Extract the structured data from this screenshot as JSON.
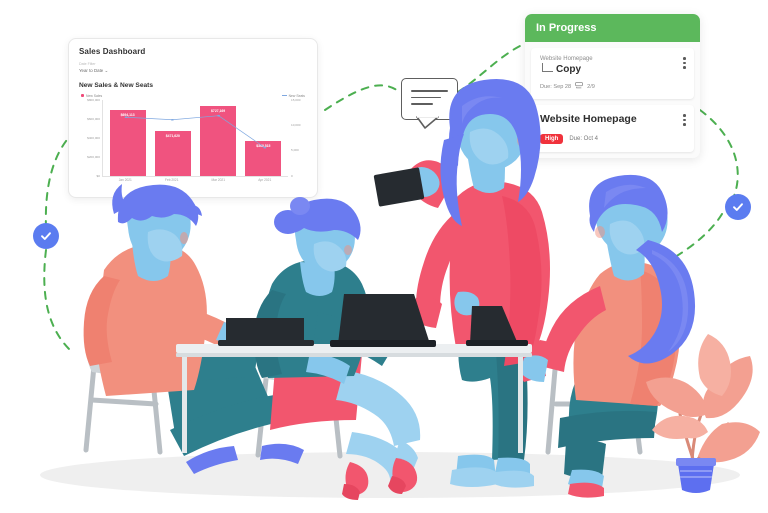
{
  "dashboard": {
    "title": "Sales Dashboard",
    "filter_label": "Date Filter",
    "filter_value": "Year to Date ⌄",
    "subtitle": "New Sales & New Seats",
    "legend": [
      {
        "name": "New Sales",
        "type": "bar",
        "color": "#ef4a79"
      },
      {
        "name": "New Seats",
        "type": "line",
        "color": "#7fa8e0"
      }
    ],
    "chart_data": {
      "type": "bar",
      "title": "New Sales & New Seats",
      "xlabel": "",
      "ylabel": "New Sales",
      "categories": [
        "Jan 2021",
        "Feb 2021",
        "Mar 2021",
        "Apr 2021"
      ],
      "values": [
        694113,
        471620,
        727169,
        368515
      ],
      "value_labels": [
        "$694,113",
        "$471,620",
        "$727,169",
        "$368,515"
      ],
      "ylim": [
        0,
        800000
      ],
      "yticks": [
        "$800,000",
        "$600,000",
        "$400,000",
        "$200,000",
        "$0"
      ],
      "ytick_values": [
        800000,
        600000,
        400000,
        200000,
        0
      ],
      "y2label": "New Seats",
      "y2lim": [
        0,
        15000
      ],
      "y2ticks": [
        "15,000",
        "10,000",
        "5,000",
        "0"
      ],
      "y2tick_values": [
        15000,
        10000,
        5000,
        0
      ],
      "series": [
        {
          "name": "New Sales",
          "type": "bar",
          "axis": "left",
          "color": "#f0537f",
          "values": [
            694113,
            471620,
            727169,
            368515
          ]
        },
        {
          "name": "New Seats",
          "type": "line",
          "axis": "right",
          "color": "#7fa8e0",
          "values": [
            11600,
            11100,
            11900,
            5600
          ]
        }
      ],
      "grid": false,
      "legend_position": "top"
    }
  },
  "kanban": {
    "column_title": "In Progress",
    "cards": [
      {
        "parent": "Website Homepage",
        "title": "Copy",
        "due": "Due: Sep 28",
        "subtasks": "2/9",
        "menu_icon": "kebab-menu-icon",
        "subtask_icon": "subtask-icon"
      },
      {
        "title": "Website Homepage",
        "priority": "High",
        "priority_color": "#f0323c",
        "due": "Due: Oct 4",
        "menu_icon": "kebab-menu-icon"
      }
    ]
  },
  "annotations": {
    "chat_bubble": {
      "icon": "chat-bubble-icon",
      "lines": 3
    },
    "check_left": {
      "icon": "check-circle-icon",
      "color": "#5b7cf0"
    },
    "check_right": {
      "icon": "check-circle-icon",
      "color": "#5b7cf0"
    },
    "connector_color": "#4caf50",
    "connector_style": "dashed"
  },
  "illustration": {
    "scene": "team-collaboration-at-desk",
    "people": [
      {
        "id": "person-left-seated",
        "top": "#f2907e",
        "bottom": "#2e7f8d",
        "hair": "#6a7bf0",
        "skin": "#86c7ec"
      },
      {
        "id": "person-second-seated",
        "top": "#2e7f8d",
        "bottom": "#f2566e",
        "hair": "#6a7bf0",
        "skin": "#86c7ec"
      },
      {
        "id": "person-standing-tablet",
        "top": "#f2566e",
        "bottom": "#2e7f8d",
        "hair": "#6a7bf0",
        "skin": "#86c7ec"
      },
      {
        "id": "person-right-seated",
        "top": "#f2907e",
        "bottom": "#2e7f8d",
        "hair": "#6a7bf0",
        "skin": "#86c7ec"
      }
    ],
    "objects": [
      {
        "id": "desk",
        "color": "#eceff1"
      },
      {
        "id": "laptop-left",
        "color": "#262b30"
      },
      {
        "id": "laptop-center",
        "color": "#262b30"
      },
      {
        "id": "laptop-right",
        "color": "#262b30"
      },
      {
        "id": "tablet",
        "color": "#262b30"
      },
      {
        "id": "plant-monstera",
        "leaf": "#f3a091",
        "pot": "#5d6ff0"
      }
    ]
  }
}
